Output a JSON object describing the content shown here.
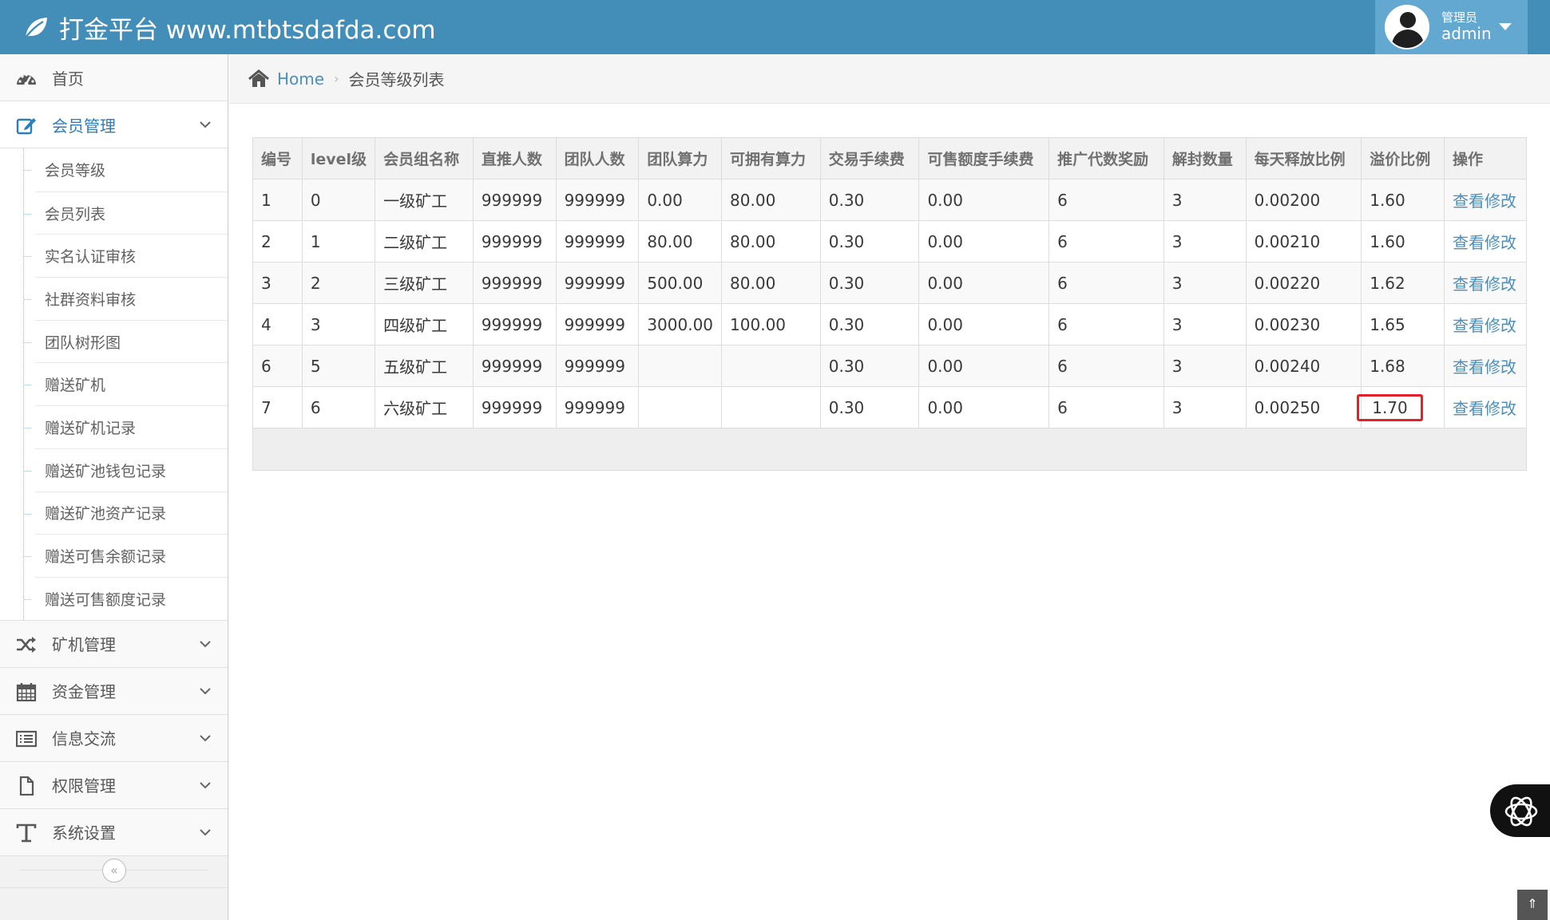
{
  "header": {
    "brand": "打金平台 www.mtbtsdafda.com",
    "user_role": "管理员",
    "user_name": "admin"
  },
  "sidebar": {
    "items": [
      {
        "label": "首页",
        "icon": "dashboard-icon"
      },
      {
        "label": "会员管理",
        "icon": "edit-icon",
        "active": true
      },
      {
        "label": "矿机管理",
        "icon": "shuffle-icon"
      },
      {
        "label": "资金管理",
        "icon": "calendar-icon"
      },
      {
        "label": "信息交流",
        "icon": "list-icon"
      },
      {
        "label": "权限管理",
        "icon": "file-icon"
      },
      {
        "label": "系统设置",
        "icon": "text-icon"
      }
    ],
    "submenu": [
      "会员等级",
      "会员列表",
      "实名认证审核",
      "社群资料审核",
      "团队树形图",
      "赠送矿机",
      "赠送矿机记录",
      "赠送矿池钱包记录",
      "赠送矿池资产记录",
      "赠送可售余额记录",
      "赠送可售额度记录"
    ],
    "collapse_glyph": "«"
  },
  "breadcrumb": {
    "home": "Home",
    "separator": "›",
    "current": "会员等级列表"
  },
  "table": {
    "headers": [
      "编号",
      "level级",
      "会员组名称",
      "直推人数",
      "团队人数",
      "团队算力",
      "可拥有算力",
      "交易手续费",
      "可售额度手续费",
      "推广代数奖励",
      "解封数量",
      "每天释放比例",
      "溢价比例",
      "操作"
    ],
    "rows": [
      [
        "1",
        "0",
        "一级矿工",
        "999999",
        "999999",
        "0.00",
        "80.00",
        "0.30",
        "0.00",
        "6",
        "3",
        "0.00200",
        "1.60",
        "查看修改"
      ],
      [
        "2",
        "1",
        "二级矿工",
        "999999",
        "999999",
        "80.00",
        "80.00",
        "0.30",
        "0.00",
        "6",
        "3",
        "0.00210",
        "1.60",
        "查看修改"
      ],
      [
        "3",
        "2",
        "三级矿工",
        "999999",
        "999999",
        "500.00",
        "80.00",
        "0.30",
        "0.00",
        "6",
        "3",
        "0.00220",
        "1.62",
        "查看修改"
      ],
      [
        "4",
        "3",
        "四级矿工",
        "999999",
        "999999",
        "3000.00",
        "100.00",
        "0.30",
        "0.00",
        "6",
        "3",
        "0.00230",
        "1.65",
        "查看修改"
      ],
      [
        "6",
        "5",
        "五级矿工",
        "999999",
        "999999",
        "",
        "",
        "0.30",
        "0.00",
        "6",
        "3",
        "0.00240",
        "1.68",
        "查看修改"
      ],
      [
        "7",
        "6",
        "六级矿工",
        "999999",
        "999999",
        "",
        "",
        "0.30",
        "0.00",
        "6",
        "3",
        "0.00250",
        "1.70",
        "查看修改"
      ]
    ],
    "highlight_color": "#e5202a"
  },
  "colors": {
    "header": "#438eb9",
    "user_box": "#62a8d1",
    "link": "#4c8fbd"
  },
  "back_to_top_glyph": "⇑"
}
